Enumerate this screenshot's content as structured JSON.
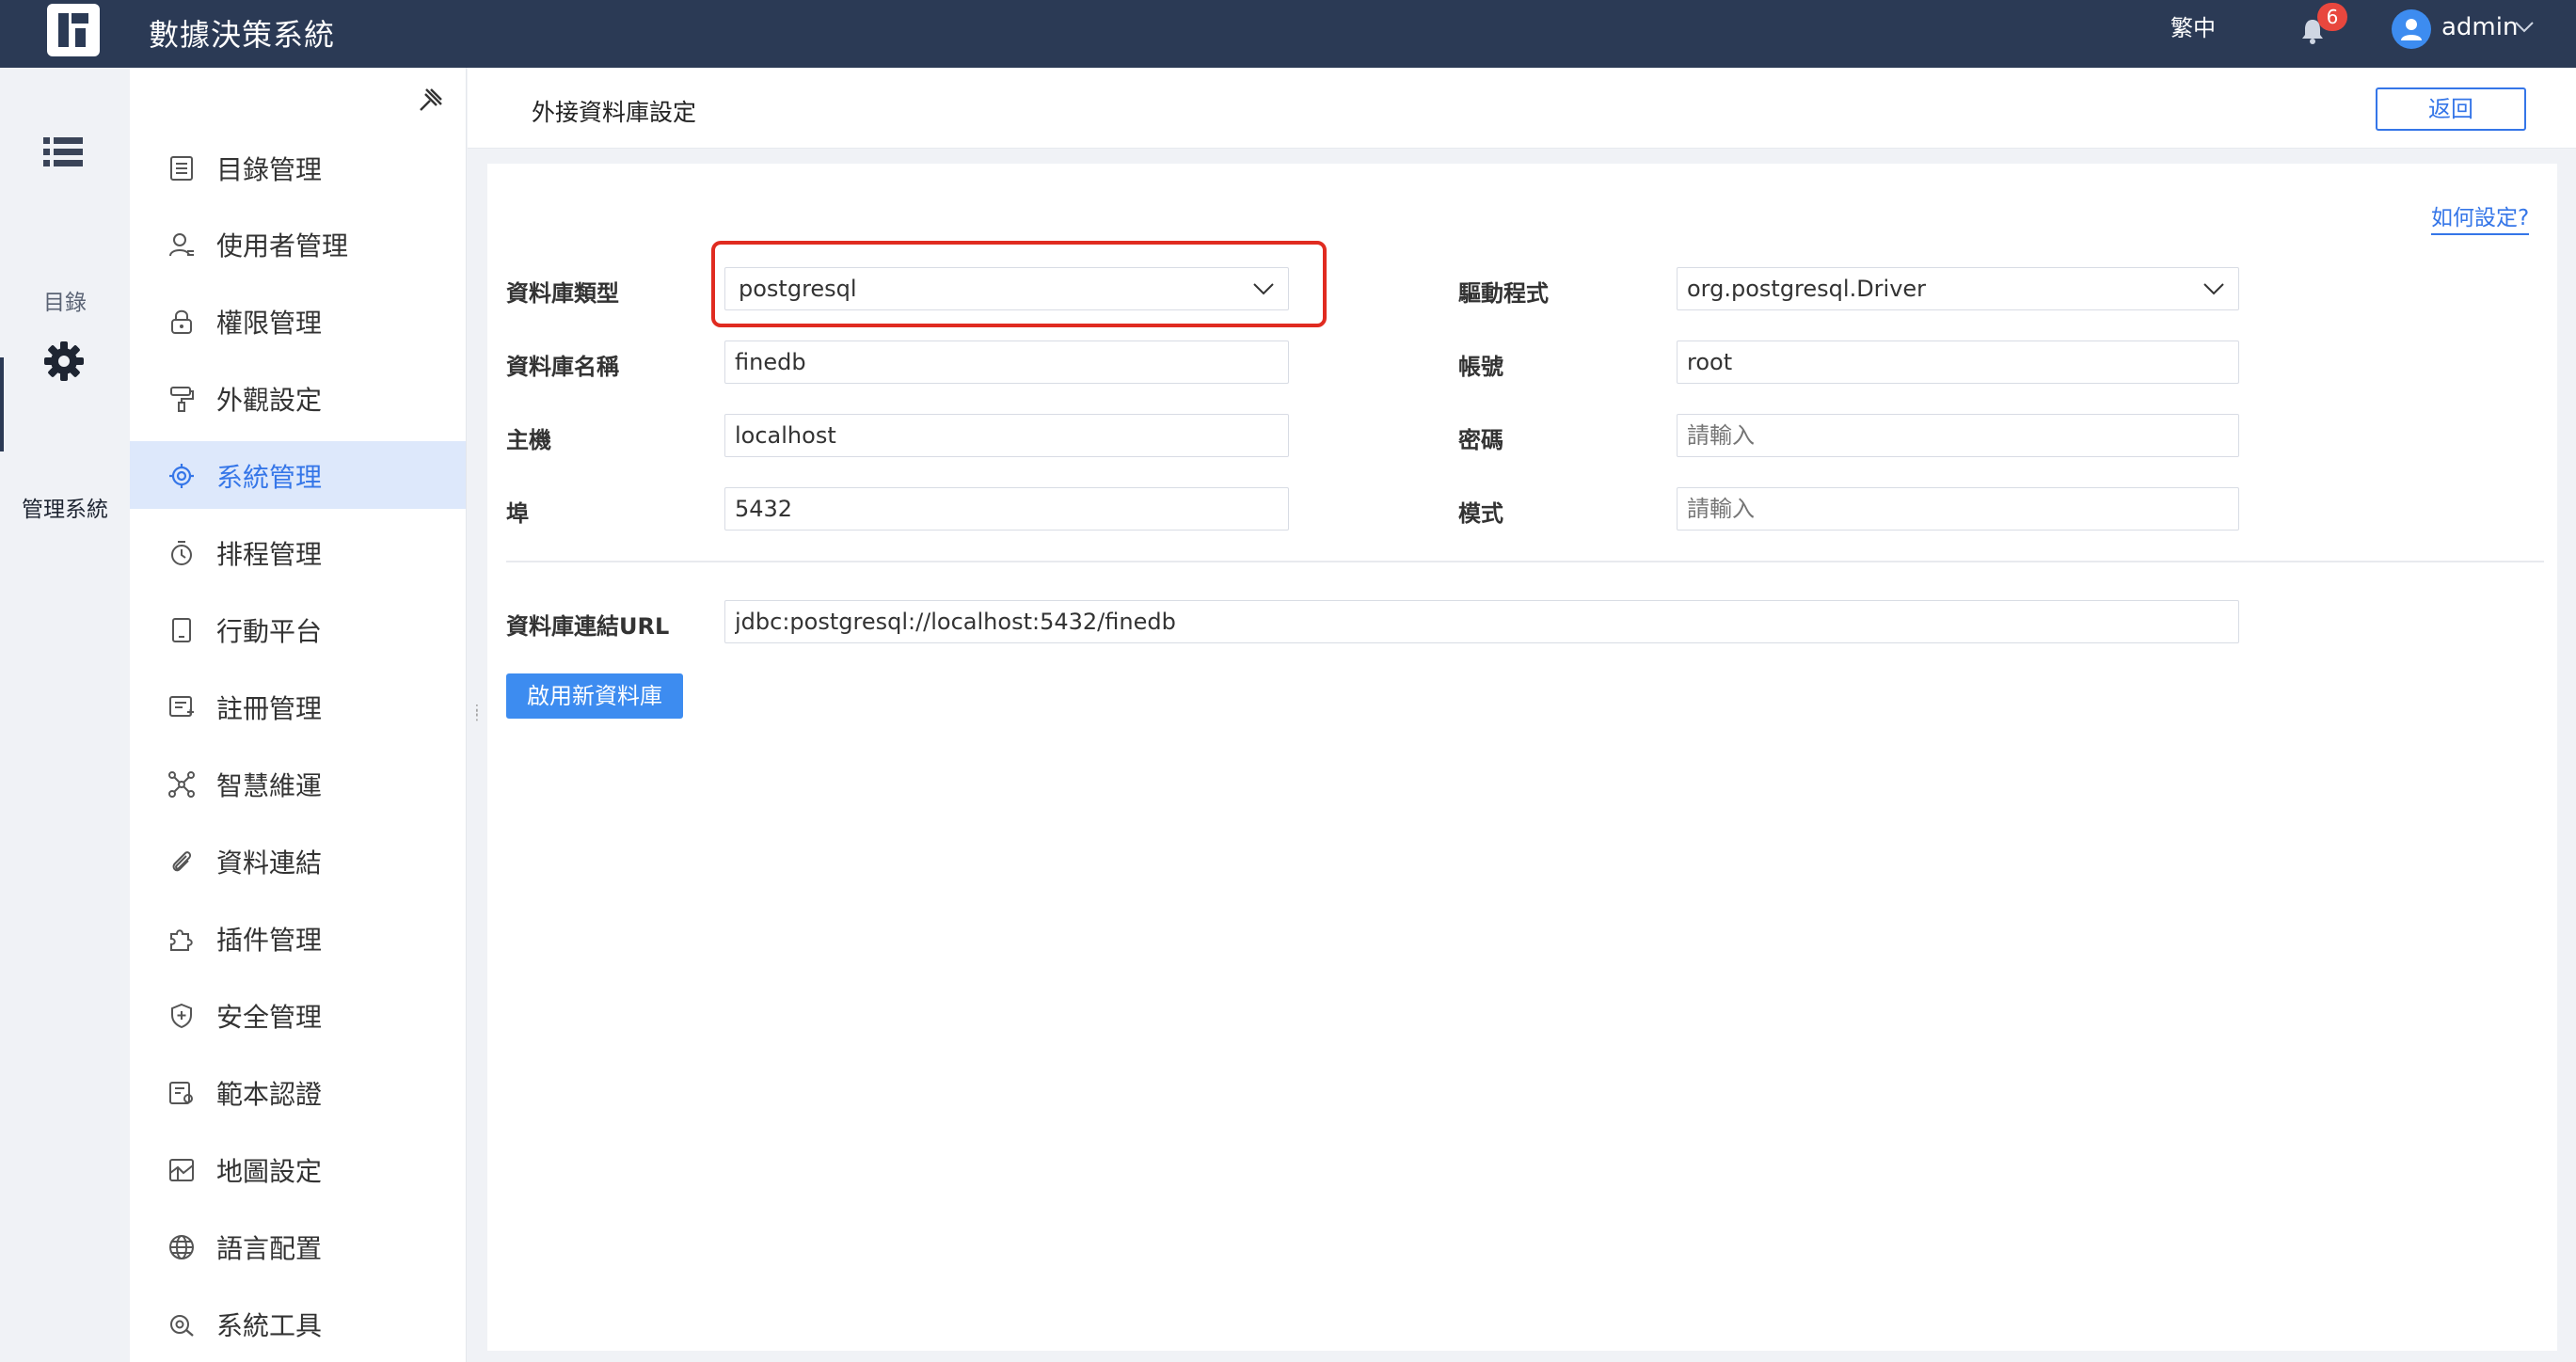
{
  "topbar": {
    "app_title": "數據決策系統",
    "language": "繁中",
    "notification_count": "6",
    "username": "admin"
  },
  "rail": {
    "items": [
      {
        "label": "目錄",
        "icon": "list-icon",
        "active": false
      },
      {
        "label": "管理系統",
        "icon": "gear-icon",
        "active": true
      }
    ]
  },
  "sidebar": {
    "items": [
      {
        "label": "目錄管理",
        "icon": "directory-icon"
      },
      {
        "label": "使用者管理",
        "icon": "user-icon"
      },
      {
        "label": "權限管理",
        "icon": "lock-icon"
      },
      {
        "label": "外觀設定",
        "icon": "paint-roller-icon"
      },
      {
        "label": "系統管理",
        "icon": "gear-icon",
        "active": true
      },
      {
        "label": "排程管理",
        "icon": "timer-icon"
      },
      {
        "label": "行動平台",
        "icon": "tablet-icon"
      },
      {
        "label": "註冊管理",
        "icon": "register-icon"
      },
      {
        "label": "智慧維運",
        "icon": "network-icon"
      },
      {
        "label": "資料連結",
        "icon": "paperclip-icon"
      },
      {
        "label": "插件管理",
        "icon": "puzzle-icon"
      },
      {
        "label": "安全管理",
        "icon": "shield-icon"
      },
      {
        "label": "範本認證",
        "icon": "template-cert-icon"
      },
      {
        "label": "地圖設定",
        "icon": "map-icon"
      },
      {
        "label": "語言配置",
        "icon": "globe-icon"
      },
      {
        "label": "系統工具",
        "icon": "tools-icon"
      }
    ]
  },
  "page": {
    "title": "外接資料庫設定",
    "back_label": "返回",
    "help_label": "如何設定?"
  },
  "form": {
    "db_type": {
      "label": "資料庫類型",
      "value": "postgresql"
    },
    "driver": {
      "label": "驅動程式",
      "value": "org.postgresql.Driver"
    },
    "db_name": {
      "label": "資料庫名稱",
      "value": "finedb"
    },
    "account": {
      "label": "帳號",
      "value": "root"
    },
    "host": {
      "label": "主機",
      "value": "localhost"
    },
    "password": {
      "label": "密碼",
      "placeholder": "請輸入"
    },
    "port": {
      "label": "埠",
      "value": "5432"
    },
    "schema": {
      "label": "模式",
      "placeholder": "請輸入"
    },
    "url": {
      "label": "資料庫連結URL",
      "value": "jdbc:postgresql://localhost:5432/finedb"
    },
    "submit_label": "啟用新資料庫"
  },
  "colors": {
    "topbar": "#2b3a55",
    "accent": "#3576e8",
    "highlight": "#e02b20",
    "badge": "#e8473e"
  }
}
